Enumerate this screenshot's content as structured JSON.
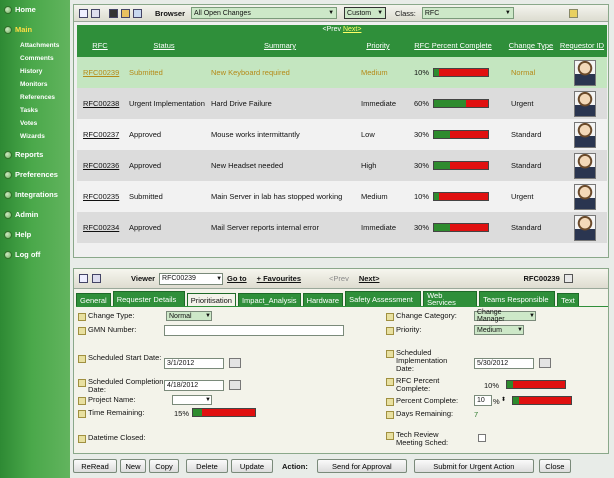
{
  "sidebar": {
    "items": [
      {
        "label": "Home"
      },
      {
        "label": "Main"
      },
      {
        "label": "Reports"
      },
      {
        "label": "Preferences"
      },
      {
        "label": "Integrations"
      },
      {
        "label": "Admin"
      },
      {
        "label": "Help"
      },
      {
        "label": "Log off"
      }
    ],
    "sub_items": [
      "Attachments",
      "Comments",
      "History",
      "Monitors",
      "References",
      "Tasks",
      "Votes",
      "Wizards"
    ]
  },
  "toolbar": {
    "browser_label": "Browser",
    "browser_value": "All Open Changes",
    "custom_value": "Custom",
    "class_label": "Class:",
    "class_value": "RFC"
  },
  "pager": {
    "prev": "<Prev",
    "next": "Next>"
  },
  "table": {
    "headers": [
      "RFC",
      "Status",
      "Summary",
      "Priority",
      "RFC Percent Complete",
      "Change Type",
      "Requestor ID"
    ],
    "rows": [
      {
        "rfc": "RFC00239",
        "status": "Submitted",
        "summary": "New Keyboard required",
        "priority": "Medium",
        "pct_text": "10%",
        "pct": 10,
        "type": "Normal"
      },
      {
        "rfc": "RFC00238",
        "status": "Urgent Implementation",
        "summary": "Hard Drive Failure",
        "priority": "Immediate",
        "pct_text": "60%",
        "pct": 60,
        "type": "Urgent"
      },
      {
        "rfc": "RFC00237",
        "status": "Approved",
        "summary": "Mouse works intermittantly",
        "priority": "Low",
        "pct_text": "30%",
        "pct": 30,
        "type": "Standard"
      },
      {
        "rfc": "RFC00236",
        "status": "Approved",
        "summary": "New Headset needed",
        "priority": "High",
        "pct_text": "30%",
        "pct": 30,
        "type": "Standard"
      },
      {
        "rfc": "RFC00235",
        "status": "Submitted",
        "summary": "Main Server in lab has stopped working",
        "priority": "Medium",
        "pct_text": "10%",
        "pct": 10,
        "type": "Urgent"
      },
      {
        "rfc": "RFC00234",
        "status": "Approved",
        "summary": "Mail Server reports internal error",
        "priority": "Immediate",
        "pct_text": "30%",
        "pct": 30,
        "type": "Standard"
      }
    ]
  },
  "viewer": {
    "label": "Viewer",
    "value": "RFC00239",
    "goto": "Go to",
    "favourites": "+ Favourites",
    "prev": "<Prev",
    "next": "Next>",
    "current_id": "RFC00239"
  },
  "tabs": [
    "General",
    "Requester Details",
    "Prioritisation",
    "Impact_Analysis",
    "Hardware",
    "Safety Assessment",
    "Web Services",
    "Teams Responsible",
    "Text"
  ],
  "form": {
    "change_type_label": "Change Type:",
    "change_type_value": "Normal",
    "gmn_label": "GMN Number:",
    "gmn_value": "",
    "sched_start_label": "Scheduled Start Date:",
    "sched_start_value": "3/1/2012",
    "sched_completion_label": "Scheduled Completion Date:",
    "sched_completion_value": "4/18/2012",
    "project_name_label": "Project Name:",
    "project_name_value": "",
    "time_remaining_label": "Time Remaining:",
    "time_remaining_text": "15%",
    "time_remaining_pct": 15,
    "datetime_closed_label": "Datetime Closed:",
    "change_category_label": "Change Category:",
    "change_category_value": "Change Manager",
    "priority_label": "Priority:",
    "priority_value": "Medium",
    "sched_impl_label": "Scheduled Implementation Date:",
    "sched_impl_value": "5/30/2012",
    "rfc_pct_label": "RFC Percent Complete:",
    "rfc_pct_text": "10%",
    "rfc_pct": 10,
    "pct_complete_label": "Percent Complete:",
    "pct_complete_value": "10",
    "pct_complete_unit": "%",
    "pct_complete_pct": 10,
    "days_remaining_label": "Days Remaining:",
    "days_remaining_value": "7",
    "tech_review_label": "Tech Review Meeting Sched:"
  },
  "actions": {
    "reread": "ReRead",
    "new": "New",
    "copy": "Copy",
    "delete": "Delete",
    "update": "Update",
    "action_label": "Action:",
    "send_approval": "Send for Approval",
    "submit_urgent": "Submit for Urgent Action",
    "close": "Close"
  }
}
